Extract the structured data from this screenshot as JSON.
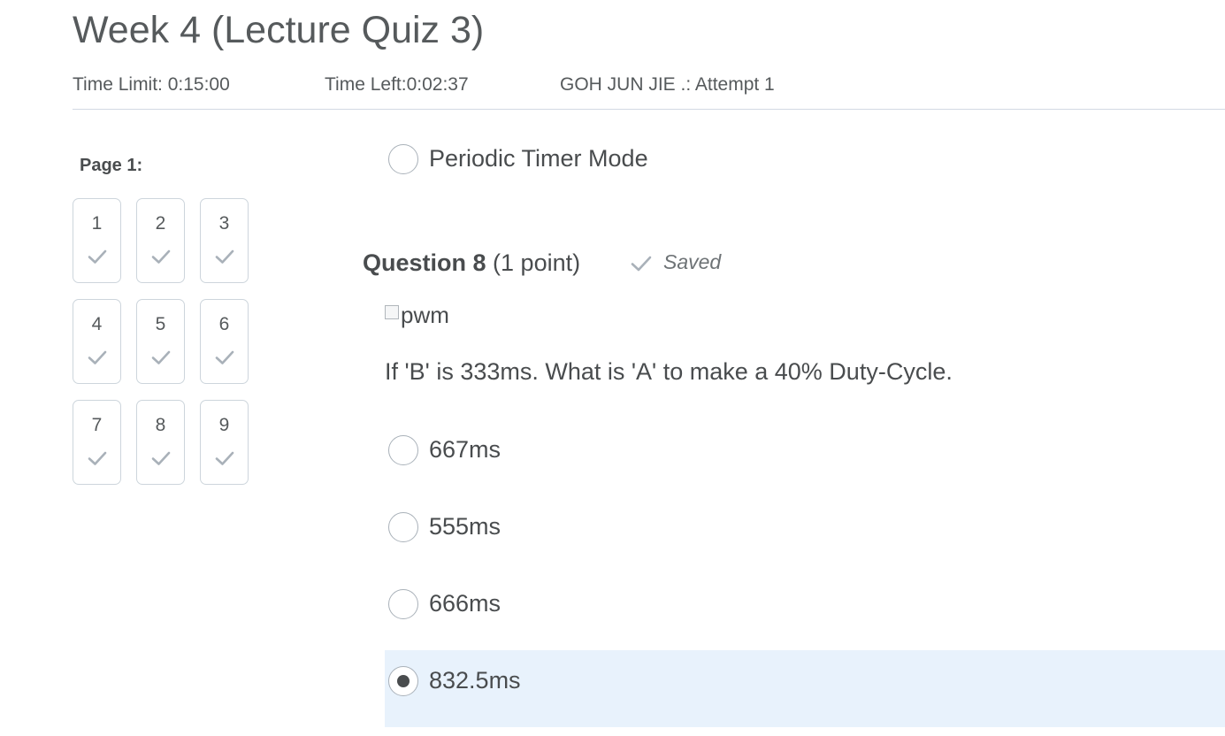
{
  "quiz": {
    "title": "Week 4 (Lecture Quiz 3)",
    "time_limit": "Time Limit: 0:15:00",
    "time_left": "Time Left:0:02:37",
    "attempt": "GOH JUN JIE .: Attempt 1"
  },
  "sidebar": {
    "page_label": "Page 1:",
    "questions": [
      {
        "number": "1",
        "answered": true
      },
      {
        "number": "2",
        "answered": true
      },
      {
        "number": "3",
        "answered": true
      },
      {
        "number": "4",
        "answered": true
      },
      {
        "number": "5",
        "answered": true
      },
      {
        "number": "6",
        "answered": true
      },
      {
        "number": "7",
        "answered": true
      },
      {
        "number": "8",
        "answered": true
      },
      {
        "number": "9",
        "answered": true
      }
    ]
  },
  "previous_question": {
    "last_option": "Periodic Timer Mode"
  },
  "question": {
    "title": "Question 8",
    "points": "(1 point)",
    "status": "Saved",
    "image_alt": "pwm",
    "text": "If 'B' is 333ms. What is 'A' to make a 40% Duty-Cycle.",
    "options": [
      {
        "label": "667ms",
        "selected": false
      },
      {
        "label": "555ms",
        "selected": false
      },
      {
        "label": "666ms",
        "selected": false
      },
      {
        "label": "832.5ms",
        "selected": true
      }
    ]
  },
  "colors": {
    "check": "#a9b1b9",
    "selected_background": "#e8f2fc",
    "text": "#494c4e"
  },
  "icons": {
    "tile_check": "checkmark-icon",
    "saved": "checkmark-icon",
    "broken_image": "broken-image-icon"
  }
}
